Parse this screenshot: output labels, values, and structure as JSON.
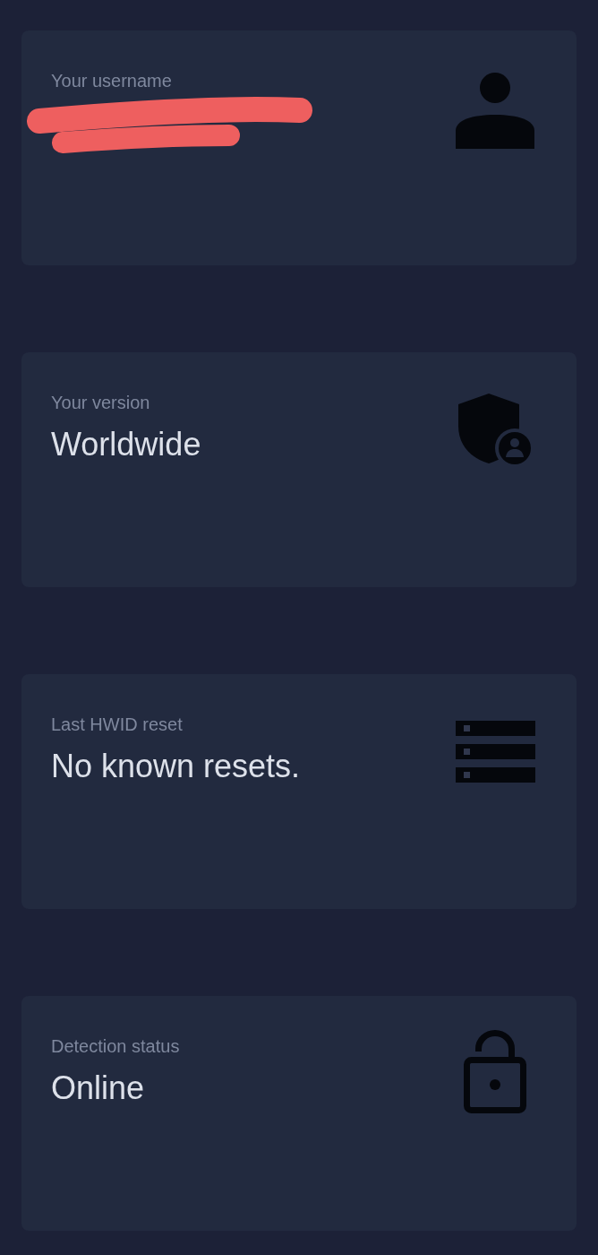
{
  "cards": [
    {
      "label": "Your username",
      "redacted": true
    },
    {
      "label": "Your version",
      "value": "Worldwide",
      "redacted": false
    },
    {
      "label": "Last HWID reset",
      "value": "No known resets.",
      "redacted": false
    },
    {
      "label": "Detection status",
      "value": "Online",
      "redacted": false
    }
  ]
}
